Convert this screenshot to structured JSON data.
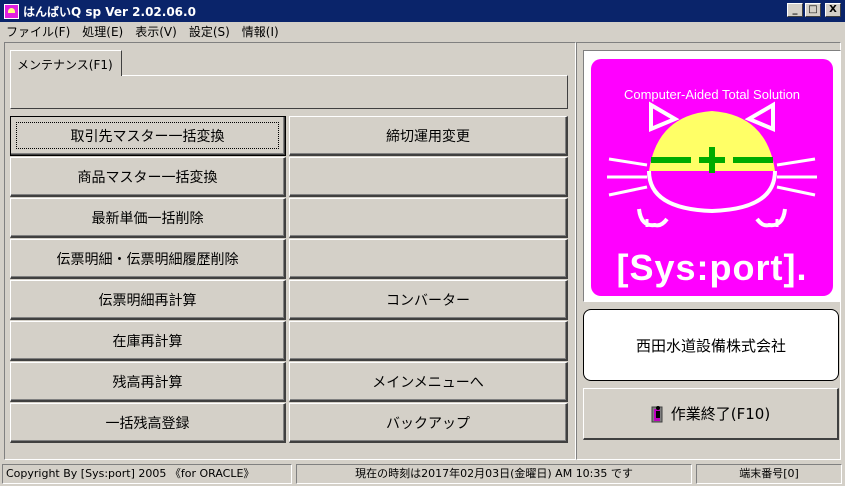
{
  "window": {
    "title": "はんばいQ sp  Ver 2.02.06.0",
    "controls": [
      "_",
      "□",
      "X"
    ]
  },
  "menubar": [
    "ファイル(F)",
    "処理(E)",
    "表示(V)",
    "設定(S)",
    "情報(I)"
  ],
  "tab": {
    "label": "メンテナンス(F1)"
  },
  "buttons": {
    "left": [
      "取引先マスター一括変換",
      "商品マスター一括変換",
      "最新単価一括削除",
      "伝票明細・伝票明細履歴削除",
      "伝票明細再計算",
      "在庫再計算",
      "残高再計算",
      "一括残高登録"
    ],
    "right": [
      "締切運用変更",
      "",
      "",
      "",
      "コンバーター",
      "",
      "メインメニューへ",
      "バックアップ"
    ]
  },
  "logo": {
    "caption": "Computer-Aided Total Solution",
    "brand": "[Sys:port].",
    "colors": {
      "background": "#ff00ff",
      "helmet": "#ffff66",
      "cross": "#00aa00",
      "lines": "#ffffff"
    }
  },
  "company": {
    "name": "西田水道設備株式会社"
  },
  "exit_button": {
    "label": "作業終了(F10)",
    "icon": "exit-person-icon"
  },
  "statusbar": {
    "copyright": "Copyright By [Sys:port] 2005 《for ORACLE》",
    "time": "現在の時刻は2017年02月03日(金曜日) AM 10:35 です",
    "terminal": "端末番号[0]"
  }
}
